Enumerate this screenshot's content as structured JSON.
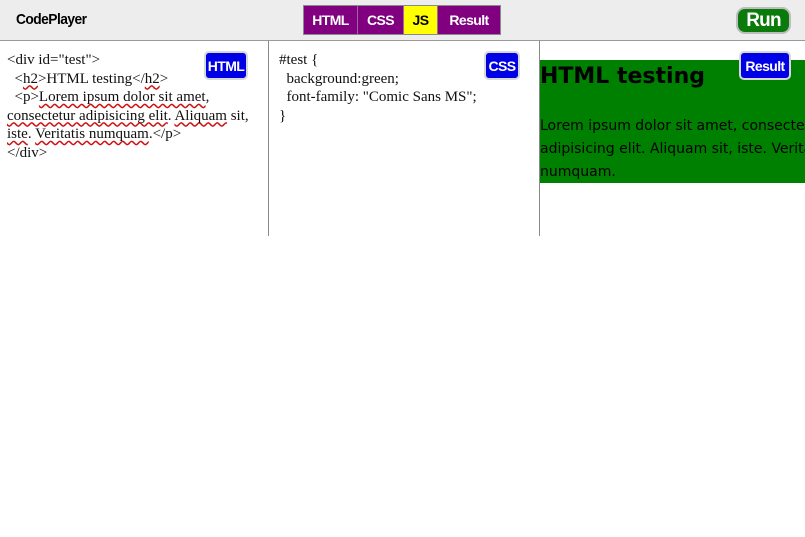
{
  "app": {
    "logo": "CodePlayer"
  },
  "toggles": [
    {
      "label": "HTML",
      "active": false
    },
    {
      "label": "CSS",
      "active": false
    },
    {
      "label": "JS",
      "active": true
    },
    {
      "label": "Result",
      "active": false
    }
  ],
  "run_label": "Run",
  "panels": {
    "html": {
      "badge": "HTML",
      "lines": {
        "l1": "<div id=\"test\">",
        "l2a": "  <",
        "l2b": "h2",
        "l2c": ">HTML testing</",
        "l2d": "h2",
        "l2e": ">",
        "l3a": "  <p>",
        "l3b": "Lorem ipsum dolor sit amet",
        "l3c": ", ",
        "l3d": "consectetur adipisicing elit",
        "l3e": ". ",
        "l3f": "Aliquam",
        "l3g": " sit, ",
        "l3h": "iste",
        "l3i": ". ",
        "l3j": "Veritatis numquam",
        "l3k": ".</p>",
        "l4": "</div>"
      }
    },
    "css": {
      "badge": "CSS",
      "code": "#test {\n  background:green;\n  font-family: \"Comic Sans MS\";\n}"
    },
    "result": {
      "badge": "Result",
      "heading": "HTML testing",
      "paragraph": "Lorem ipsum dolor sit amet, consectetur adipisicing elit. Aliquam sit, iste. Veritatis numquam.",
      "background_color": "#008000"
    }
  },
  "colors": {
    "toggle_bg": "#800080",
    "toggle_active_bg": "#ffff00",
    "badge_bg": "#0000e6",
    "run_bg": "#0a7a0a",
    "topbar_bg": "#ededed"
  }
}
